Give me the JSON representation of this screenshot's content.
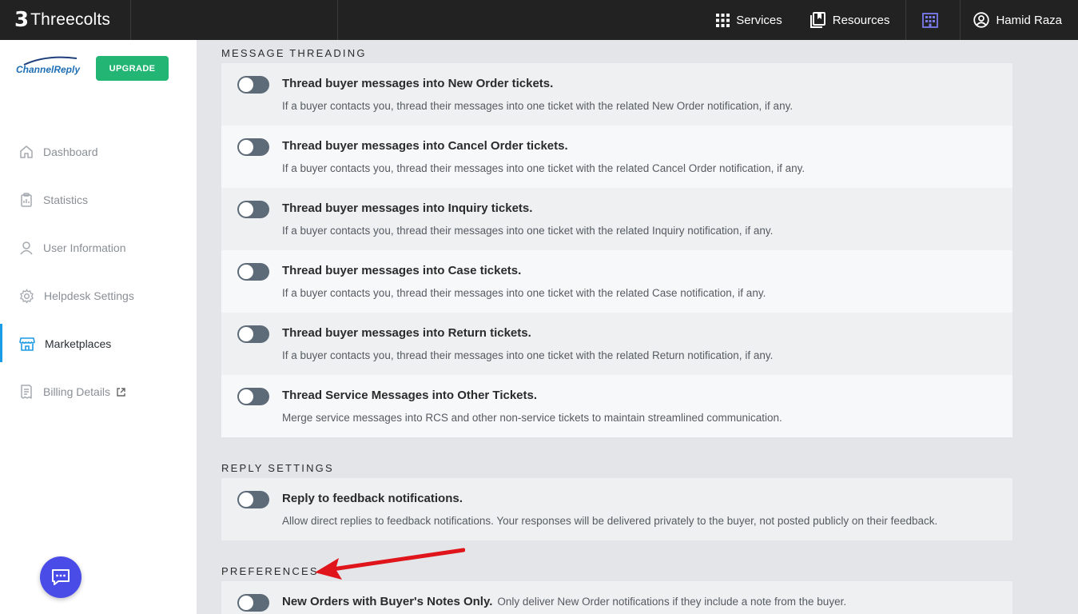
{
  "topbar": {
    "brand": "Threecolts",
    "brand_mark": "3",
    "services": "Services",
    "resources": "Resources",
    "user": "Hamid Raza"
  },
  "sidebar": {
    "logo_text": "ChannelReply",
    "upgrade": "UPGRADE",
    "items": [
      {
        "label": "Dashboard",
        "icon": "home-icon"
      },
      {
        "label": "Statistics",
        "icon": "clipboard-icon"
      },
      {
        "label": "User Information",
        "icon": "user-icon"
      },
      {
        "label": "Helpdesk Settings",
        "icon": "gear-icon"
      },
      {
        "label": "Marketplaces",
        "icon": "store-icon",
        "active": true
      },
      {
        "label": "Billing Details",
        "icon": "receipt-icon",
        "external": true
      }
    ]
  },
  "sections": {
    "threading": {
      "title": "MESSAGE THREADING",
      "rows": [
        {
          "title": "Thread buyer messages into New Order tickets.",
          "desc": "If a buyer contacts you, thread their messages into one ticket with the related New Order notification, if any."
        },
        {
          "title": "Thread buyer messages into Cancel Order tickets.",
          "desc": "If a buyer contacts you, thread their messages into one ticket with the related Cancel Order notification, if any."
        },
        {
          "title": "Thread buyer messages into Inquiry tickets.",
          "desc": "If a buyer contacts you, thread their messages into one ticket with the related Inquiry notification, if any."
        },
        {
          "title": "Thread buyer messages into Case tickets.",
          "desc": "If a buyer contacts you, thread their messages into one ticket with the related Case notification, if any."
        },
        {
          "title": "Thread buyer messages into Return tickets.",
          "desc": "If a buyer contacts you, thread their messages into one ticket with the related Return notification, if any."
        },
        {
          "title": "Thread Service Messages into Other Tickets.",
          "desc": "Merge service messages into RCS and other non-service tickets to maintain streamlined communication."
        }
      ]
    },
    "reply": {
      "title": "REPLY SETTINGS",
      "rows": [
        {
          "title": "Reply to feedback notifications.",
          "desc": "Allow direct replies to feedback notifications. Your responses will be delivered privately to the buyer, not posted publicly on their feedback."
        }
      ]
    },
    "preferences": {
      "title": "PREFERENCES",
      "rows": [
        {
          "title": "New Orders with Buyer's Notes Only.",
          "desc": "Only deliver New Order notifications if they include a note from the buyer."
        }
      ]
    }
  },
  "colors": {
    "accent_blue": "#1b9ae6",
    "upgrade_green": "#22b573",
    "chat_purple": "#4a4ce8",
    "annotation_arrow": "#e0141b",
    "toggle_off": "#5d6a78"
  }
}
